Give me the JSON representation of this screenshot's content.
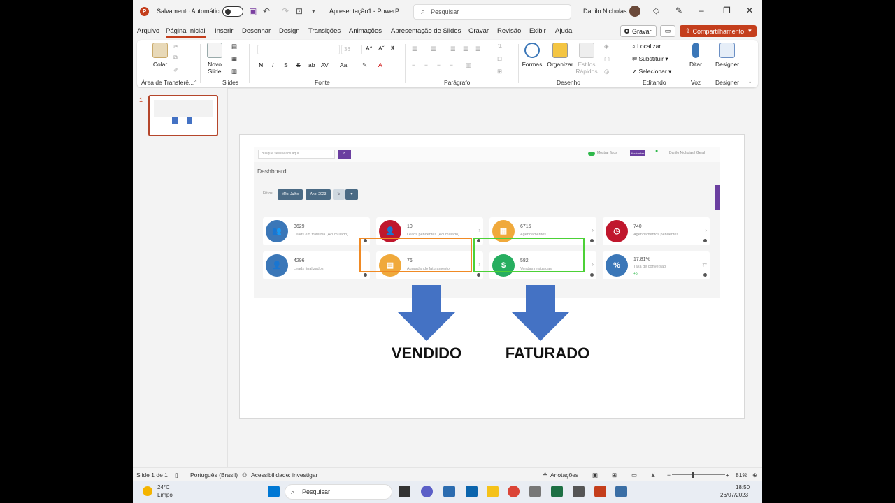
{
  "titlebar": {
    "autosave_label": "Salvamento Automático",
    "doc_title": "Apresentação1 - PowerP...",
    "search_placeholder": "Pesquisar",
    "user_name": "Danilo Nicholas"
  },
  "menu": {
    "tabs": [
      "Arquivo",
      "Página Inicial",
      "Inserir",
      "Desenhar",
      "Design",
      "Transições",
      "Animações",
      "Apresentação de Slides",
      "Gravar",
      "Revisão",
      "Exibir",
      "Ajuda"
    ],
    "record_label": "Gravar",
    "share_label": "Compartilhamento"
  },
  "ribbon": {
    "paste_label": "Colar",
    "clipboard_group": "Área de Transferê...",
    "new_slide_label": "Novo Slide",
    "slides_group": "Slides",
    "font_group": "Fonte",
    "font_size": "36",
    "paragraph_group": "Parágrafo",
    "shapes_label": "Formas",
    "arrange_label": "Organizar",
    "quick_styles_label": "Estilos Rápidos",
    "drawing_group": "Desenho",
    "find_label": "Localizar",
    "replace_label": "Substituir",
    "select_label": "Selecionar",
    "editing_group": "Editando",
    "dictate_label": "Ditar",
    "voice_group": "Voz",
    "designer_label": "Designer",
    "designer_group": "Designer"
  },
  "thumbnails": {
    "slide_number": "1"
  },
  "slide": {
    "dashboard": {
      "search_placeholder": "Busque seus leads aqui...",
      "show_hide": "Mostrar fixos",
      "news_badge": "Novidades",
      "user_label": "Danilo Nicholas | Geral",
      "title": "Dashboard",
      "filters_label": "Filtros:",
      "filter_month": "Mês: Julho",
      "filter_year": "Ano: 2023",
      "cards": [
        {
          "value": "3629",
          "label": "Leads em tratativa (Acumulado)",
          "color": "#3b77b8",
          "icon": "users-icon"
        },
        {
          "value": "10",
          "label": "Leads pendentes (Acumulado)",
          "color": "#c0172d",
          "icon": "user-clock-icon"
        },
        {
          "value": "6715",
          "label": "Agendamentos",
          "color": "#f0a93b",
          "icon": "calendar-icon"
        },
        {
          "value": "740",
          "label": "Agendamentos pendentes",
          "color": "#c0172d",
          "icon": "clock-icon"
        },
        {
          "value": "4296",
          "label": "Leads finalizados",
          "color": "#3b77b8",
          "icon": "user-check-icon"
        },
        {
          "value": "76",
          "label": "Aguardando faturamento",
          "color": "#f0a93b",
          "icon": "document-icon"
        },
        {
          "value": "582",
          "label": "Vendas realizadas",
          "color": "#27ae60",
          "icon": "dollar-icon"
        },
        {
          "value": "17,81%",
          "label": "Taxa de conversão",
          "sub": "+5",
          "color": "#3b77b8",
          "icon": "percent-icon"
        }
      ]
    },
    "label_left": "VENDIDO",
    "label_right": "FATURADO",
    "arrow_color": "#4472c4"
  },
  "status": {
    "slide_info": "Slide 1 de 1",
    "language": "Português (Brasil)",
    "accessibility": "Acessibilidade: investigar",
    "notes": "Anotações",
    "zoom": "81%"
  },
  "taskbar": {
    "temp": "24°C",
    "weather": "Limpo",
    "search": "Pesquisar",
    "time": "18:50",
    "date": "26/07/2023"
  }
}
